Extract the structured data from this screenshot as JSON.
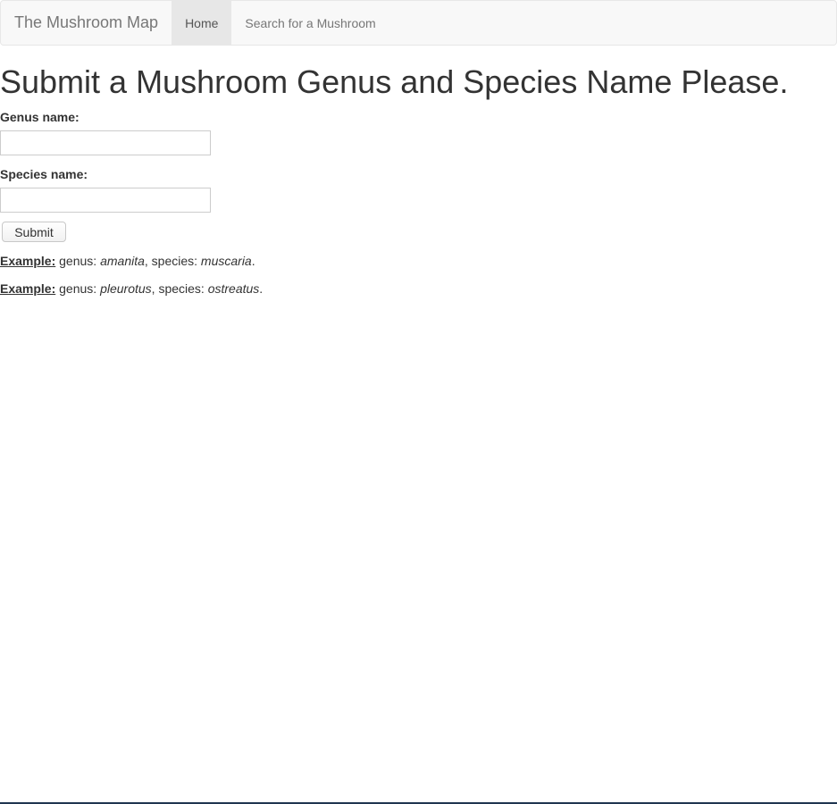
{
  "navbar": {
    "brand": "The Mushroom Map",
    "items": [
      {
        "label": "Home",
        "active": true
      },
      {
        "label": "Search for a Mushroom",
        "active": false
      }
    ]
  },
  "page": {
    "heading": "Submit a Mushroom Genus and Species Name Please."
  },
  "form": {
    "genus_label": "Genus name:",
    "genus_value": "",
    "species_label": "Species name:",
    "species_value": "",
    "submit_label": "Submit"
  },
  "examples": [
    {
      "label": "Example:",
      "genus_prefix": "genus:",
      "genus": "amanita",
      "species_prefix": ", species:",
      "species": "muscaria",
      "suffix": "."
    },
    {
      "label": "Example:",
      "genus_prefix": "genus:",
      "genus": "pleurotus",
      "species_prefix": ", species:",
      "species": "ostreatus",
      "suffix": "."
    }
  ]
}
